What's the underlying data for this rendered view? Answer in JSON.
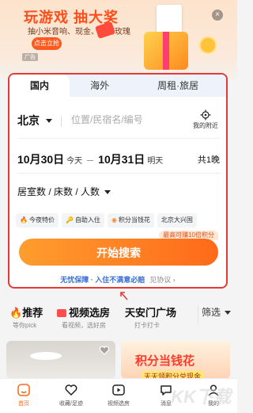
{
  "banner": {
    "title": "玩游戏 抽大奖",
    "subtitle": "抽小米音响、现金、豪密玫瑰",
    "cta": "点击立抢",
    "ad_tag": "广告"
  },
  "tabs": [
    {
      "label": "国内",
      "active": true
    },
    {
      "label": "海外",
      "active": false
    },
    {
      "label": "周租·旅居",
      "active": false
    }
  ],
  "search": {
    "city": "北京",
    "placeholder": "位置/民宿名/编号",
    "locate_label": "我的附近",
    "checkin_date": "10月30日",
    "checkin_day": "今天",
    "checkout_date": "10月31日",
    "checkout_day": "明天",
    "nights": "共1晚",
    "room_selector": "居室数 / 床数 / 人数",
    "chips": [
      {
        "icon": "🔥",
        "icon_name": "fire-icon",
        "label": "今夜特价"
      },
      {
        "icon": "🔑",
        "icon_name": "key-icon",
        "label": "自助入住"
      },
      {
        "icon": "◉",
        "icon_name": "coin-icon",
        "label": "积分当钱花"
      },
      {
        "icon": "",
        "icon_name": "",
        "label": "北京大兴国"
      }
    ],
    "points_badge": "最高可赚10倍积分",
    "button": "开始搜索",
    "guarantee_main": "无忧保障 · 入住不满意必赔",
    "guarantee_link": "见协议 ›"
  },
  "features": [
    {
      "title": "推荐",
      "sub": "等你pick",
      "icon_name": "fire-icon"
    },
    {
      "title": "视频选房",
      "sub": "看视频，选好房",
      "icon_name": "video-icon"
    },
    {
      "title": "天安门广场",
      "sub": "打卡打卡",
      "icon_name": ""
    }
  ],
  "filter_label": "筛选",
  "promo": {
    "title": "积分当钱花",
    "sub": "天天领积分兑现金"
  },
  "nav": [
    {
      "label": "首页",
      "icon_name": "home-icon",
      "active": true
    },
    {
      "label": "收藏/足迹",
      "icon_name": "heart-icon",
      "active": false
    },
    {
      "label": "视频选房",
      "icon_name": "video-icon",
      "active": false
    },
    {
      "label": "消息",
      "icon_name": "message-icon",
      "active": false
    },
    {
      "label": "我的",
      "icon_name": "user-icon",
      "active": false
    }
  ],
  "watermark": "KK下载",
  "colors": {
    "accent": "#ff6a1a",
    "highlight_border": "#e53935",
    "link_blue": "#3a6fd8"
  }
}
